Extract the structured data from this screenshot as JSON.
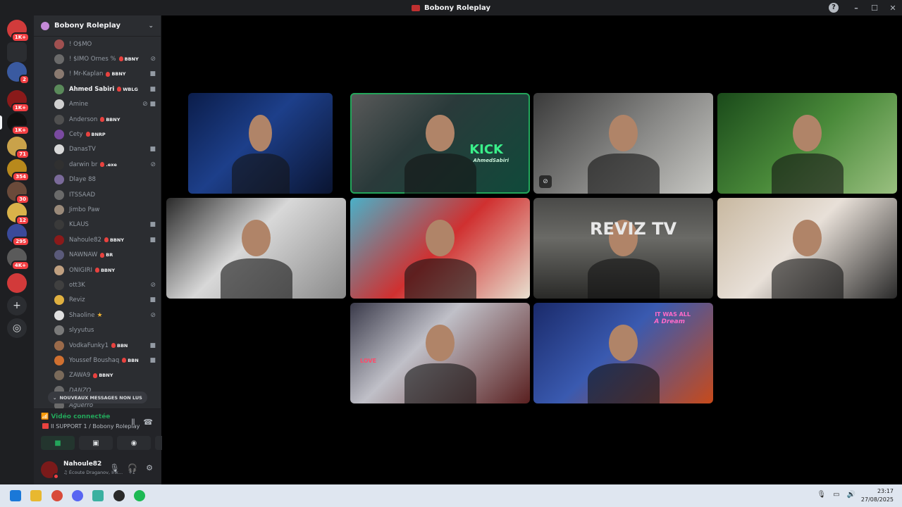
{
  "window": {
    "title": "Bobony Roleplay"
  },
  "servers": [
    {
      "badge": "1K+",
      "color": "#d13b3b"
    },
    {
      "badge": "",
      "color": "#2b2d31"
    },
    {
      "badge": "2",
      "color": "#3a5aa0"
    },
    {
      "badge": "1K+",
      "color": "#8a1a1a"
    },
    {
      "badge": "1K+",
      "color": "#111111"
    },
    {
      "badge": "71",
      "color": "#c9a24a"
    },
    {
      "badge": "354",
      "color": "#b8891c"
    },
    {
      "badge": "30",
      "color": "#6a4a3a"
    },
    {
      "badge": "12",
      "color": "#d9b24a"
    },
    {
      "badge": "295",
      "color": "#3a4a9a"
    },
    {
      "badge": "4K+",
      "color": "#5a5a5a"
    },
    {
      "badge": "",
      "color": "#d23a3a"
    }
  ],
  "guild": {
    "name": "Bobony Roleplay"
  },
  "members": [
    {
      "name": "! O$MO",
      "tag": "",
      "status": "",
      "color": "#a05050"
    },
    {
      "name": "! $IMO Ornes %",
      "tag": "BBNY",
      "status": "mute",
      "color": "#6a6a6a"
    },
    {
      "name": "! Mr-Kaplan",
      "tag": "BBNY",
      "status": "cam",
      "color": "#8a7a70"
    },
    {
      "name": "Ahmed Sabiri",
      "tag": "WBLG",
      "status": "cam",
      "color": "#5a8a5a",
      "bold": true
    },
    {
      "name": "Amine",
      "tag": "",
      "status": "mutecam",
      "color": "#d0d0d0"
    },
    {
      "name": "Anderson",
      "tag": "BBNY",
      "status": "",
      "color": "#505050"
    },
    {
      "name": "Cety",
      "tag": "BNRP",
      "status": "",
      "color": "#7a4aa0"
    },
    {
      "name": "DanasTV",
      "tag": "",
      "status": "cam",
      "color": "#d8d8d8"
    },
    {
      "name": "darwin br",
      "tag": ".exe",
      "status": "mute",
      "color": "#303030"
    },
    {
      "name": "Dlaye 88",
      "tag": "",
      "status": "",
      "color": "#7a6a9a"
    },
    {
      "name": "ITSSAAD",
      "tag": "",
      "status": "",
      "color": "#6a6a6a"
    },
    {
      "name": "Jimbo Paw",
      "tag": "",
      "status": "",
      "color": "#9a8a7a"
    },
    {
      "name": "KLAUS",
      "tag": "",
      "status": "cam",
      "color": "#3a3a3a"
    },
    {
      "name": "Nahoule82",
      "tag": "BBNY",
      "status": "cam",
      "color": "#8a1a1a"
    },
    {
      "name": "NAWNAW",
      "tag": "BR",
      "status": "",
      "color": "#5a5a7a"
    },
    {
      "name": "ONIGIRI",
      "tag": "BBNY",
      "status": "",
      "color": "#c0a080"
    },
    {
      "name": "ott3K",
      "tag": "",
      "status": "mute",
      "color": "#404040"
    },
    {
      "name": "Reviz",
      "tag": "",
      "status": "cam",
      "color": "#e0b040"
    },
    {
      "name": "Shaoline",
      "tag": "",
      "status": "mute",
      "color": "#e0e0e0",
      "star": true
    },
    {
      "name": "slyyutus",
      "tag": "",
      "status": "",
      "color": "#7a7a7a"
    },
    {
      "name": "VodkaFunky1",
      "tag": "BBN",
      "status": "cam",
      "color": "#9a6a4a"
    },
    {
      "name": "Youssef Boushaq",
      "tag": "BBN",
      "status": "cam",
      "color": "#d07030"
    },
    {
      "name": "ZAWA9",
      "tag": "BBNY",
      "status": "",
      "color": "#7a6a5a"
    },
    {
      "name": "DANZO",
      "tag": "",
      "status": "",
      "color": "#6a6a6a"
    },
    {
      "name": "Aguerro",
      "tag": "",
      "status": "",
      "color": "#6a6a6a"
    }
  ],
  "unread": {
    "label": "NOUVEAUX MESSAGES NON LUS"
  },
  "voice": {
    "status": "Vidéo connectée",
    "channel": "II SUPPORT 1 / Bobony Roleplay"
  },
  "user": {
    "name": "Nahoule82",
    "activity": "Écoute Draganov, Ink...",
    "extra": "+1"
  },
  "tiles": [
    {
      "bg": "linear-gradient(135deg,#0b1d4a,#1d3f8a 45%,#0a1430)",
      "text": "",
      "speaking": false,
      "muted": false
    },
    {
      "bg": "linear-gradient(135deg,#5a5a5a,#2a3a3a 40%,#0f4a3a)",
      "text": "KICK",
      "sub": "AhmedSabiri",
      "speaking": true,
      "muted": false
    },
    {
      "bg": "linear-gradient(135deg,#3a3a3a,#8a8a88 55%,#c8c8c4)",
      "text": "",
      "speaking": false,
      "muted": true
    },
    {
      "bg": "linear-gradient(135deg,#1a4a1a,#4a8a3a 50%,#9ac080)",
      "text": "",
      "speaking": false,
      "muted": false
    },
    {
      "bg": "linear-gradient(135deg,#2a2a2a,#d8d8d8 45%,#8a8a8a)",
      "text": "",
      "speaking": false,
      "muted": false
    },
    {
      "bg": "linear-gradient(135deg,#4ab0c8,#d03030 50%,#e8e0d0)",
      "text": "",
      "speaking": false,
      "muted": false
    },
    {
      "bg": "linear-gradient(180deg,#4a4a48,#6a6a66 40%,#2a2a28)",
      "text": "REVIZ TV",
      "sub": "",
      "speaking": false,
      "muted": false
    },
    {
      "bg": "linear-gradient(135deg,#c8b8a0,#e8e0d8 45%,#2a2a2a)",
      "text": "",
      "speaking": false,
      "muted": false
    },
    {
      "bg": "linear-gradient(135deg,#3a3a4a,#c0c0c8 40%,#5a2020)",
      "text": "LOVE",
      "sub": "",
      "speaking": false,
      "muted": false
    },
    {
      "bg": "linear-gradient(135deg,#1a2a6a,#3a5ab0 45%,#c84a1a)",
      "text": "IT WAS ALL",
      "sub": "A Dream",
      "speaking": false,
      "muted": false
    }
  ],
  "taskbar": {
    "time": "23:17",
    "date": "27/08/2025"
  }
}
